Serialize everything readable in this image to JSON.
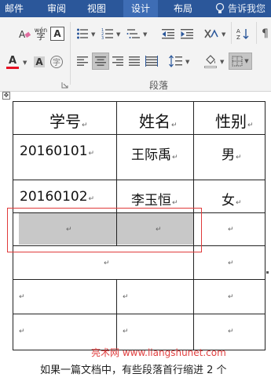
{
  "tabs": {
    "mail": "邮件",
    "review": "审阅",
    "view": "视图",
    "design": "设计",
    "layout": "布局",
    "tell_me": "告诉我您"
  },
  "ribbon": {
    "group_label": "段落",
    "wen_label": "wén",
    "char_border_label": "A",
    "font_color_label": "A",
    "font_size_label": "Aa",
    "enclose_label": "字"
  },
  "colors": {
    "ribbon_blue": "#2b579a",
    "font_color_underline": "#e81123",
    "highlight_red": "#e03a3a"
  },
  "table": {
    "headers": [
      "学号",
      "姓名",
      "性别"
    ],
    "rows": [
      [
        "20160101",
        "王际禹",
        "男"
      ],
      [
        "20160102",
        "李玉恒",
        "女"
      ]
    ],
    "cell_mark": "↵"
  },
  "watermark": "亮术网 www.liangshunet.com",
  "body_text": "如果一篇文档中，有些段落首行缩进 2 个"
}
